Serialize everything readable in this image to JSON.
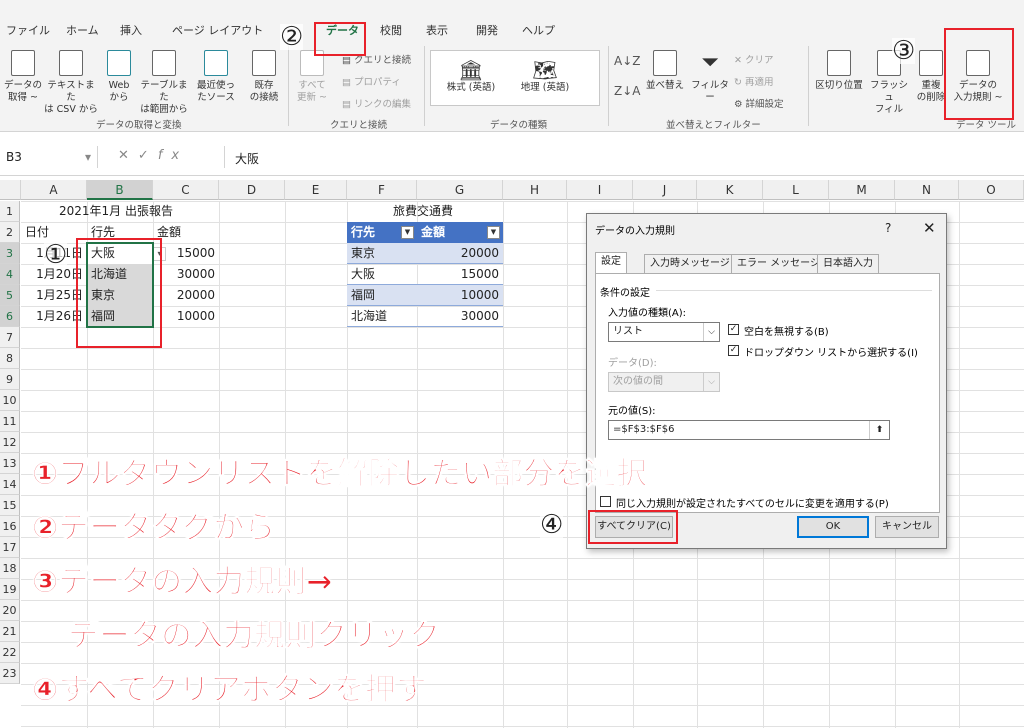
{
  "ribbon_tabs": [
    "ファイル",
    "ホーム",
    "挿入",
    "ページ レイアウト",
    "データ",
    "校閲",
    "表示",
    "開発",
    "ヘルプ"
  ],
  "ribbon": {
    "get_data": [
      "データの",
      "取得 ~"
    ],
    "text_csv": [
      "テキストまた",
      "は CSV から"
    ],
    "web": [
      "Web",
      "から"
    ],
    "from_table": [
      "テーブルまた",
      "は範囲から"
    ],
    "recent": [
      "最近使っ",
      "たソース"
    ],
    "existing": [
      "既存",
      "の接続"
    ],
    "group_get": "データの取得と変換",
    "refresh_all": [
      "すべて",
      "更新 ~"
    ],
    "queries": "クエリと接続",
    "properties": "プロパティ",
    "edit_links": "リンクの編集",
    "group_query": "クエリと接続",
    "stocks": "株式 (英語)",
    "geography": "地理 (英語)",
    "group_types": "データの種類",
    "sort": "並べ替え",
    "filter": "フィルター",
    "clear": "クリア",
    "reapply": "再適用",
    "advanced": "詳細設定",
    "group_sort": "並べ替えとフィルター",
    "text_to_cols": "区切り位置",
    "flash_fill": [
      "フラッシュ",
      "フィル"
    ],
    "remove_dup": [
      "重複",
      "の削除"
    ],
    "validation": [
      "データの",
      "入力規則 ~"
    ],
    "group_tools": "データ ツール"
  },
  "formula_bar": {
    "name_box": "B3",
    "fx": "fx",
    "value": "大阪"
  },
  "columns": [
    "A",
    "B",
    "C",
    "D",
    "E",
    "F",
    "G",
    "H",
    "I",
    "J",
    "K",
    "L",
    "M",
    "N",
    "O"
  ],
  "rows": [
    "1",
    "2",
    "3",
    "4",
    "5",
    "6",
    "7",
    "8",
    "9",
    "10",
    "11",
    "12",
    "13",
    "14",
    "15",
    "16",
    "17",
    "18",
    "19",
    "20",
    "21",
    "22",
    "23"
  ],
  "sheet": {
    "report_title": "2021年1月 出張報告",
    "h_date": "日付",
    "h_dest": "行先",
    "h_amount": "金額",
    "records": [
      {
        "date": "1月11日",
        "dest": "大阪",
        "amount": "15000"
      },
      {
        "date": "1月20日",
        "dest": "北海道",
        "amount": "30000"
      },
      {
        "date": "1月25日",
        "dest": "東京",
        "amount": "20000"
      },
      {
        "date": "1月26日",
        "dest": "福岡",
        "amount": "10000"
      }
    ],
    "table_title": "旅費交通費",
    "t_h_dest": "行先",
    "t_h_amount": "金額",
    "table_rows": [
      {
        "dest": "東京",
        "amount": "20000"
      },
      {
        "dest": "大阪",
        "amount": "15000"
      },
      {
        "dest": "福岡",
        "amount": "10000"
      },
      {
        "dest": "北海道",
        "amount": "30000"
      }
    ]
  },
  "dialog": {
    "title": "データの入力規則",
    "help": "?",
    "close": "✕",
    "tabs": [
      "設定",
      "入力時メッセージ",
      "エラー メッセージ",
      "日本語入力"
    ],
    "criteria": "条件の設定",
    "allow_label": "入力値の種類(A):",
    "allow_value": "リスト",
    "ignore_blank": "空白を無視する(B)",
    "in_cell_dropdown": "ドロップダウン リストから選択する(I)",
    "data_label": "データ(D):",
    "data_value": "次の値の間",
    "source_label": "元の値(S):",
    "source_value": "=$F$3:$F$6",
    "apply_all": "同じ入力規則が設定されたすべてのセルに変更を適用する(P)",
    "clear_all": "すべてクリア(C)",
    "ok": "OK",
    "cancel": "キャンセル"
  },
  "markers": [
    "①",
    "②",
    "③",
    "④"
  ],
  "instructions": [
    "①プルダウンリストを解除したい部分を選択",
    "②データタグから",
    "③データの入力規則→",
    "データの入力規則クリック",
    "④すべてクリアボタンを押す"
  ],
  "colors": {
    "accent": "#217346",
    "annotation": "#e8212a",
    "table_header": "#4472c4",
    "table_band": "#d9e1f2"
  }
}
